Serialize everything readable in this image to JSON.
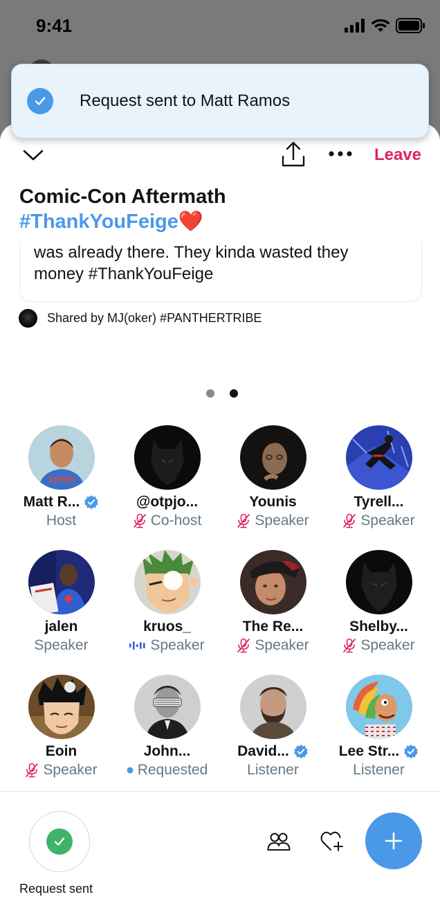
{
  "status_bar": {
    "time": "9:41"
  },
  "toast": {
    "text": "Request sent to Matt Ramos"
  },
  "controls": {
    "leave_label": "Leave"
  },
  "space": {
    "title_text": "Comic-Con Aftermath",
    "title_hashtag": "#ThankYouFeige",
    "title_emoji": "❤️",
    "tweet_line1": "was already there. They kinda wasted they",
    "tweet_line2": "money  #ThankYouFeige",
    "shared_by": "Shared by MJ(oker) #PANTHERTRIBE"
  },
  "pager": {
    "active_page": 2,
    "page_count": 2
  },
  "participants": [
    {
      "name": "Matt R...",
      "role": "Host",
      "verified": true,
      "mic": "none",
      "avatar": "blue-shirt-person"
    },
    {
      "name": "@otpjo...",
      "role": "Co-host",
      "verified": false,
      "mic": "muted",
      "avatar": "black-panther"
    },
    {
      "name": "Younis",
      "role": "Speaker",
      "verified": false,
      "mic": "muted",
      "avatar": "dark-portrait"
    },
    {
      "name": "Tyrell...",
      "role": "Speaker",
      "verified": false,
      "mic": "muted",
      "avatar": "spider-hero"
    },
    {
      "name": "jalen",
      "role": "Speaker",
      "verified": false,
      "mic": "none",
      "avatar": "superman-shirt"
    },
    {
      "name": "kruos_",
      "role": "Speaker",
      "verified": false,
      "mic": "speaking",
      "avatar": "anime-character"
    },
    {
      "name": "The Re...",
      "role": "Speaker",
      "verified": false,
      "mic": "muted",
      "avatar": "cap-portrait"
    },
    {
      "name": "Shelby...",
      "role": "Speaker",
      "verified": false,
      "mic": "muted",
      "avatar": "black-panther"
    },
    {
      "name": "Eoin",
      "role": "Speaker",
      "verified": false,
      "mic": "muted",
      "avatar": "anime-boy"
    },
    {
      "name": "John...",
      "role": "Requested",
      "verified": false,
      "mic": "requested",
      "avatar": "shutter-shades"
    },
    {
      "name": "David...",
      "role": "Listener",
      "verified": true,
      "mic": "none",
      "avatar": "bearded-man"
    },
    {
      "name": "Lee Str...",
      "role": "Listener",
      "verified": true,
      "mic": "none",
      "avatar": "cartoon-character"
    }
  ],
  "bottom_bar": {
    "request_label": "Request sent"
  },
  "colors": {
    "accent": "#4a99e9",
    "danger": "#e0245e",
    "muted_mic": "#e0245e",
    "success": "#3fb36a",
    "secondary_text": "#657786",
    "speaking_wave": "#3b5bdb"
  }
}
